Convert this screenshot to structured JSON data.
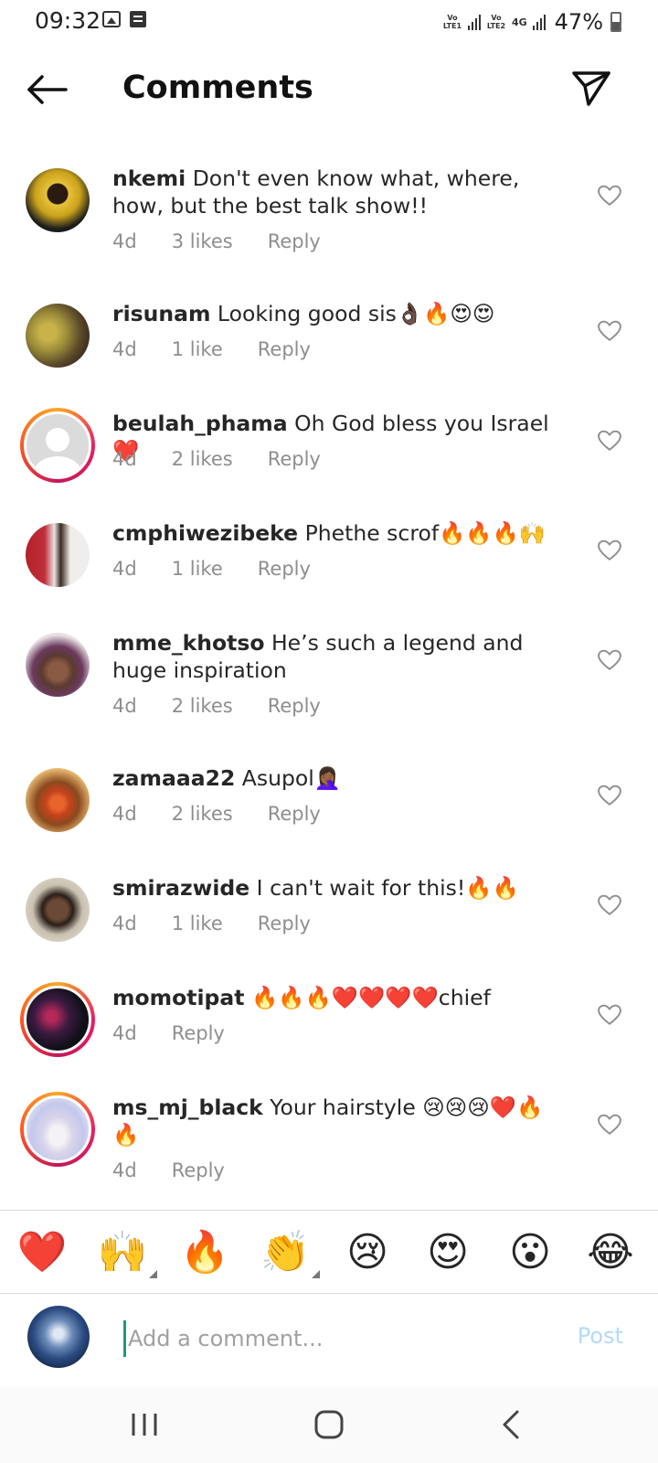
{
  "status_bar": {
    "time": "09:32",
    "net1_label": "Vo LTE1",
    "net2_label": "Vo LTE2",
    "net_type": "4G",
    "battery": "47%"
  },
  "header": {
    "title": "Comments",
    "icons": [
      "back-arrow-icon",
      "send-icon"
    ]
  },
  "comments": [
    {
      "username": "nkemi",
      "text": "Don't even know what, where, how, but the best talk show!!",
      "time": "4d",
      "likes": "3 likes",
      "reply": "Reply",
      "story_ring": false
    },
    {
      "username": "risunam",
      "text": "Looking good sis👌🏿🔥😍😍",
      "time": "4d",
      "likes": "1 like",
      "reply": "Reply",
      "story_ring": false
    },
    {
      "username": "beulah_phama",
      "text": "Oh God bless you Israel ❤️",
      "time": "4d",
      "likes": "2 likes",
      "reply": "Reply",
      "story_ring": true
    },
    {
      "username": "cmphiwezibeke",
      "text": "Phethe scrof🔥🔥🔥🙌",
      "time": "4d",
      "likes": "1 like",
      "reply": "Reply",
      "story_ring": false
    },
    {
      "username": "mme_khotso",
      "text": "He’s such a legend and huge inspiration",
      "time": "4d",
      "likes": "2 likes",
      "reply": "Reply",
      "story_ring": false
    },
    {
      "username": "zamaaa22",
      "text": "Asupol🤦🏾‍♀️",
      "time": "4d",
      "likes": "2 likes",
      "reply": "Reply",
      "story_ring": false
    },
    {
      "username": "smirazwide",
      "text": "I can't wait for this!🔥🔥",
      "time": "4d",
      "likes": "1 like",
      "reply": "Reply",
      "story_ring": false
    },
    {
      "username": "momotipat",
      "text": "🔥🔥🔥❤️❤️❤️❤️chief",
      "time": "4d",
      "likes": "",
      "reply": "Reply",
      "story_ring": true
    },
    {
      "username": "ms_mj_black",
      "text": "Your hairstyle 😢😢😢❤️🔥🔥",
      "time": "4d",
      "likes": "",
      "reply": "Reply",
      "story_ring": true
    }
  ],
  "reactions": [
    "❤️",
    "🙌",
    "🔥",
    "👏",
    "😢",
    "😍",
    "😮",
    "😂"
  ],
  "composer": {
    "placeholder": "Add a comment...",
    "post_label": "Post"
  },
  "colors": {
    "post_disabled": "#b3dbf9",
    "meta_gray": "#8e8e8e",
    "cursor": "#1c9a7a"
  }
}
